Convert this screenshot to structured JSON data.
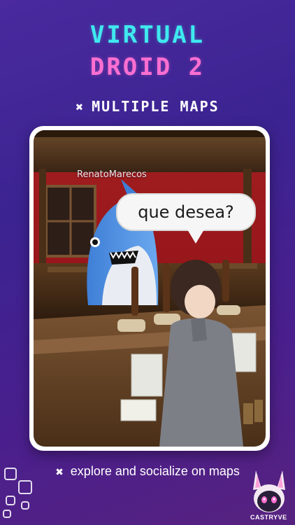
{
  "header": {
    "title_line1": "Virtual",
    "title_line2": "Droid 2",
    "feature_label": "Multiple Maps",
    "feature_icon": "x-icon"
  },
  "screenshot": {
    "player_name": "RenatoMarecos",
    "speech_bubble": "que desea?"
  },
  "footer": {
    "tagline": "explore and socialize on maps",
    "tagline_icon": "x-icon"
  },
  "brand": {
    "name": "CASTRYVE"
  },
  "colors": {
    "title_cyan": "#3fe9ef",
    "title_pink": "#ff6fd2",
    "background": "#4a2a9e"
  }
}
